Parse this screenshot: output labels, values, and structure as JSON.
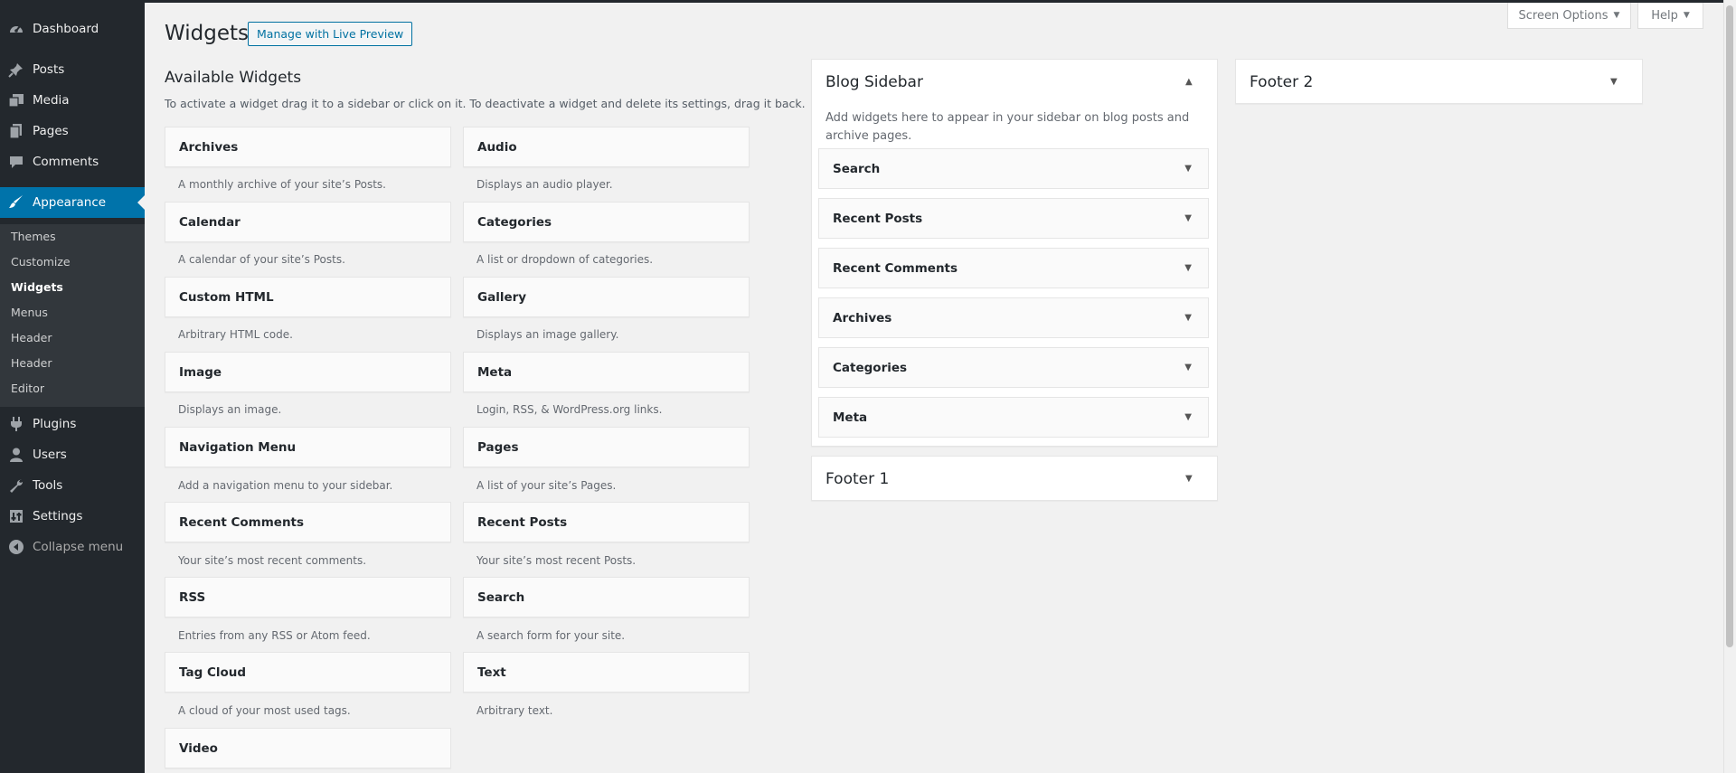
{
  "admin_menu": {
    "items": [
      {
        "label": "Dashboard",
        "icon": "dashboard-icon"
      },
      {
        "label": "Posts",
        "icon": "pushpin-icon"
      },
      {
        "label": "Media",
        "icon": "media-icon"
      },
      {
        "label": "Pages",
        "icon": "pages-icon"
      },
      {
        "label": "Comments",
        "icon": "comment-icon"
      },
      {
        "label": "Appearance",
        "icon": "brush-icon"
      },
      {
        "label": "Plugins",
        "icon": "plug-icon"
      },
      {
        "label": "Users",
        "icon": "user-icon"
      },
      {
        "label": "Tools",
        "icon": "wrench-icon"
      },
      {
        "label": "Settings",
        "icon": "settings-icon"
      },
      {
        "label": "Collapse menu",
        "icon": "collapse-icon"
      }
    ],
    "submenu": [
      "Themes",
      "Customize",
      "Widgets",
      "Menus",
      "Header",
      "Header",
      "Editor"
    ],
    "current_item": "Appearance",
    "current_submenu": "Widgets"
  },
  "screen_meta": {
    "screen_options": "Screen Options",
    "help": "Help"
  },
  "page": {
    "title": "Widgets",
    "live_preview": "Manage with Live Preview"
  },
  "available": {
    "heading": "Available Widgets",
    "description": "To activate a widget drag it to a sidebar or click on it. To deactivate a widget and delete its settings, drag it back.",
    "widgets": [
      {
        "name": "Archives",
        "desc": "A monthly archive of your site’s Posts."
      },
      {
        "name": "Audio",
        "desc": "Displays an audio player."
      },
      {
        "name": "Calendar",
        "desc": "A calendar of your site’s Posts."
      },
      {
        "name": "Categories",
        "desc": "A list or dropdown of categories."
      },
      {
        "name": "Custom HTML",
        "desc": "Arbitrary HTML code."
      },
      {
        "name": "Gallery",
        "desc": "Displays an image gallery."
      },
      {
        "name": "Image",
        "desc": "Displays an image."
      },
      {
        "name": "Meta",
        "desc": "Login, RSS, & WordPress.org links."
      },
      {
        "name": "Navigation Menu",
        "desc": "Add a navigation menu to your sidebar."
      },
      {
        "name": "Pages",
        "desc": "A list of your site’s Pages."
      },
      {
        "name": "Recent Comments",
        "desc": "Your site’s most recent comments."
      },
      {
        "name": "Recent Posts",
        "desc": "Your site’s most recent Posts."
      },
      {
        "name": "RSS",
        "desc": "Entries from any RSS or Atom feed."
      },
      {
        "name": "Search",
        "desc": "A search form for your site."
      },
      {
        "name": "Tag Cloud",
        "desc": "A cloud of your most used tags."
      },
      {
        "name": "Text",
        "desc": "Arbitrary text."
      },
      {
        "name": "Video",
        "desc": ""
      }
    ]
  },
  "sidebars": {
    "blog": {
      "title": "Blog Sidebar",
      "description": "Add widgets here to appear in your sidebar on blog posts and archive pages.",
      "expanded": true,
      "widgets": [
        "Search",
        "Recent Posts",
        "Recent Comments",
        "Archives",
        "Categories",
        "Meta"
      ]
    },
    "footer1": {
      "title": "Footer 1",
      "expanded": false
    },
    "footer2": {
      "title": "Footer 2",
      "expanded": false
    }
  }
}
